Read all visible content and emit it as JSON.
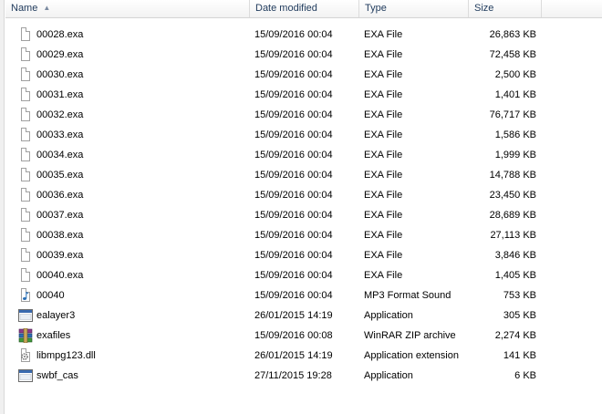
{
  "columns": {
    "name": "Name",
    "date": "Date modified",
    "type": "Type",
    "size": "Size"
  },
  "files": [
    {
      "name": "00028.exa",
      "date": "15/09/2016 00:04",
      "type": "EXA File",
      "size": "26,863 KB",
      "icon": "blank-file-icon"
    },
    {
      "name": "00029.exa",
      "date": "15/09/2016 00:04",
      "type": "EXA File",
      "size": "72,458 KB",
      "icon": "blank-file-icon"
    },
    {
      "name": "00030.exa",
      "date": "15/09/2016 00:04",
      "type": "EXA File",
      "size": "2,500 KB",
      "icon": "blank-file-icon"
    },
    {
      "name": "00031.exa",
      "date": "15/09/2016 00:04",
      "type": "EXA File",
      "size": "1,401 KB",
      "icon": "blank-file-icon"
    },
    {
      "name": "00032.exa",
      "date": "15/09/2016 00:04",
      "type": "EXA File",
      "size": "76,717 KB",
      "icon": "blank-file-icon"
    },
    {
      "name": "00033.exa",
      "date": "15/09/2016 00:04",
      "type": "EXA File",
      "size": "1,586 KB",
      "icon": "blank-file-icon"
    },
    {
      "name": "00034.exa",
      "date": "15/09/2016 00:04",
      "type": "EXA File",
      "size": "1,999 KB",
      "icon": "blank-file-icon"
    },
    {
      "name": "00035.exa",
      "date": "15/09/2016 00:04",
      "type": "EXA File",
      "size": "14,788 KB",
      "icon": "blank-file-icon"
    },
    {
      "name": "00036.exa",
      "date": "15/09/2016 00:04",
      "type": "EXA File",
      "size": "23,450 KB",
      "icon": "blank-file-icon"
    },
    {
      "name": "00037.exa",
      "date": "15/09/2016 00:04",
      "type": "EXA File",
      "size": "28,689 KB",
      "icon": "blank-file-icon"
    },
    {
      "name": "00038.exa",
      "date": "15/09/2016 00:04",
      "type": "EXA File",
      "size": "27,113 KB",
      "icon": "blank-file-icon"
    },
    {
      "name": "00039.exa",
      "date": "15/09/2016 00:04",
      "type": "EXA File",
      "size": "3,846 KB",
      "icon": "blank-file-icon"
    },
    {
      "name": "00040.exa",
      "date": "15/09/2016 00:04",
      "type": "EXA File",
      "size": "1,405 KB",
      "icon": "blank-file-icon"
    },
    {
      "name": "00040",
      "date": "15/09/2016 00:04",
      "type": "MP3 Format Sound",
      "size": "753 KB",
      "icon": "audio-file-icon"
    },
    {
      "name": "ealayer3",
      "date": "26/01/2015 14:19",
      "type": "Application",
      "size": "305 KB",
      "icon": "application-icon"
    },
    {
      "name": "exafiles",
      "date": "15/09/2016 00:08",
      "type": "WinRAR ZIP archive",
      "size": "2,274 KB",
      "icon": "winrar-archive-icon"
    },
    {
      "name": "libmpg123.dll",
      "date": "26/01/2015 14:19",
      "type": "Application extension",
      "size": "141 KB",
      "icon": "dll-gear-icon"
    },
    {
      "name": "swbf_cas",
      "date": "27/11/2015 19:28",
      "type": "Application",
      "size": "6 KB",
      "icon": "application-icon"
    }
  ],
  "colors": {
    "header_text": "#1e395b",
    "file_border": "#a0a0a0",
    "audio_note": "#2a6fb5"
  }
}
